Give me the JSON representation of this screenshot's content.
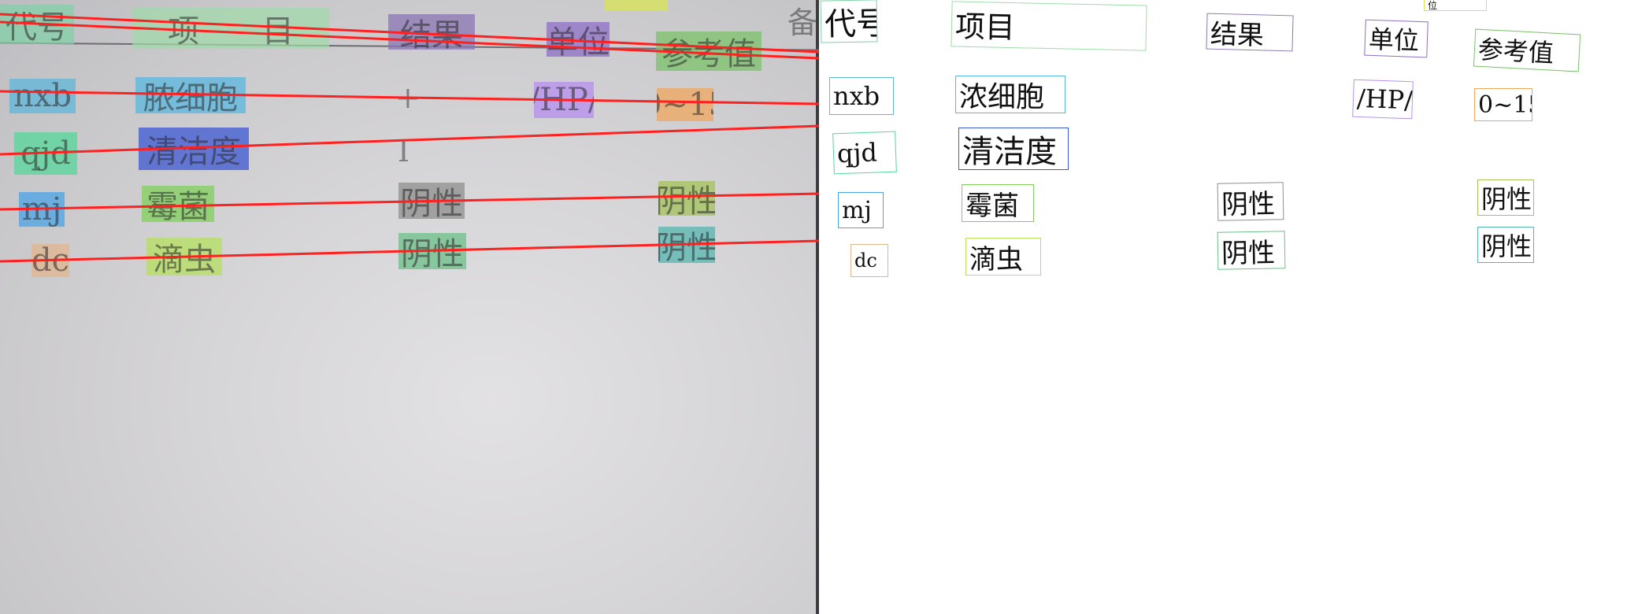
{
  "fields": {
    "code": "代号",
    "item": "项目",
    "item_photo": "项　　目",
    "result": "结果",
    "unit": "单位",
    "unit_partial": "位",
    "reference": "参考值",
    "row1_code": "nxb",
    "row1_item": "浓细胞",
    "row1_item_photo": "脓细胞",
    "row1_result": "+",
    "row1_unit": "/HP/",
    "row1_ref": "0~15",
    "row2_code": "qjd",
    "row2_item": "清洁度",
    "row2_result": "I",
    "row3_code": "mj",
    "row3_item": "霉菌",
    "row3_result": "阴性",
    "row3_ref": "阴性",
    "row4_code": "dc",
    "row4_item": "滴虫",
    "row4_result": "阴性",
    "row4_ref": "阴性",
    "edge_char": "备"
  },
  "colors": {
    "code": "#7fd1a6",
    "item": "#9fdca8",
    "result": "#8a76b3",
    "unit": "#8e6fc7",
    "reference": "#7bc26a",
    "top_partial": "#d7e45a",
    "row1_code": "#5fb7d9",
    "row1_item": "#58b7e0",
    "row1_unit": "#b58ef0",
    "row1_ref": "#f0a55e",
    "row2_code": "#54d79a",
    "row2_item": "#3c57d2",
    "row3_code": "#4aa3e6",
    "row3_item": "#7fd05a",
    "row3_result": "#8f8f8f",
    "row3_ref": "#a4c25a",
    "row4_code": "#e2b48a",
    "row4_item": "#b6e05e",
    "row4_result": "#6cc08a",
    "row4_ref": "#55b5b0",
    "red_line": "#ff2020"
  }
}
